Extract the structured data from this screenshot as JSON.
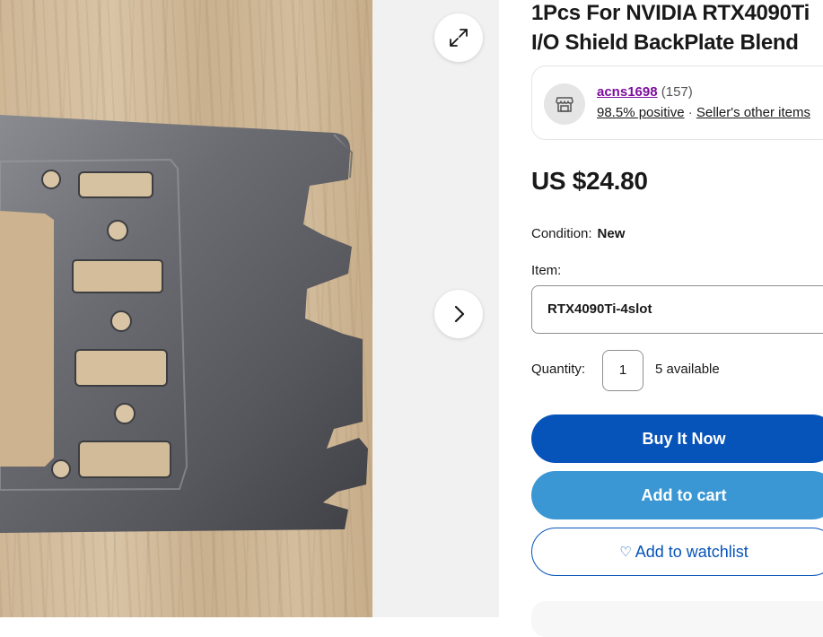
{
  "gallery": {
    "photo_alt": "",
    "expand_icon": "expand-icon",
    "next_icon": "chevron-right-icon"
  },
  "listing": {
    "title_line1": "1Pcs For NVIDIA RTX4090Ti",
    "title_line2": "I/O Shield BackPlate Blend"
  },
  "seller": {
    "icon": "store-icon",
    "name": "acns1698",
    "feedback_count": "(157)",
    "positive": "98.5% positive",
    "separator": "·",
    "other_items": "Seller's other items"
  },
  "price": "US $24.80",
  "condition": {
    "label": "Condition:",
    "value": "New"
  },
  "item": {
    "label": "Item:",
    "selected": "RTX4090Ti-4slot"
  },
  "quantity": {
    "label": "Quantity:",
    "value": "1",
    "available": "5 available"
  },
  "buttons": {
    "buy_now": "Buy It Now",
    "add_to_cart": "Add to cart",
    "watchlist_icon": "heart-icon",
    "add_to_watchlist": "Add to watchlist"
  },
  "colors": {
    "primary": "#0654ba",
    "secondary": "#3a97d3",
    "seller_link": "#7d0e9e"
  }
}
